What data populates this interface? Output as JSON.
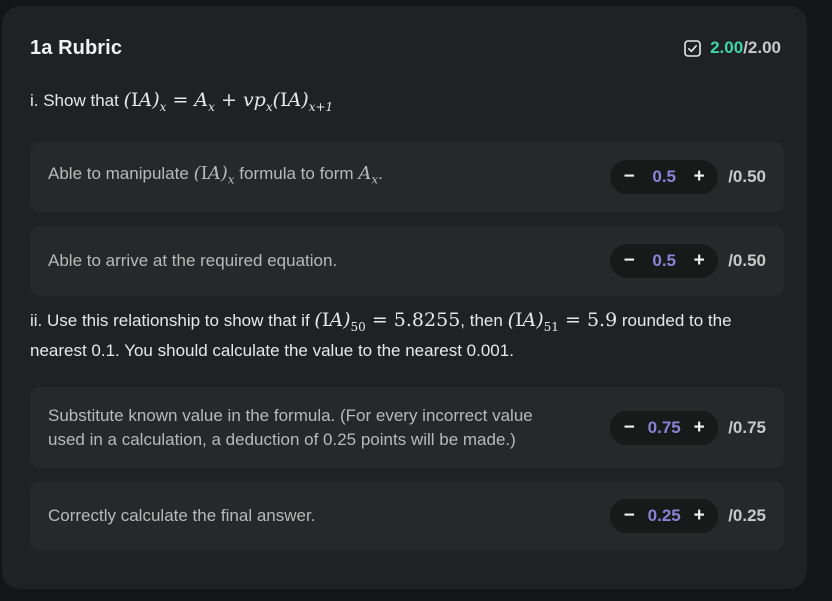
{
  "rubric": {
    "title": "1a Rubric",
    "score_earned": "2.00",
    "score_sep_total": "/2.00",
    "check_icon": "checkbox-checked-icon"
  },
  "part_i": {
    "prefix": "i. Show that",
    "equation": "(IA)x = Ax + vpx(IA)x+1"
  },
  "part_ii": {
    "line1_a": "ii. Use this relationship to show that if",
    "line1_b": ", then",
    "line1_c": "rounded to the",
    "line2": "nearest 0.1. You should calculate the value to the nearest 0.001.",
    "value_50": "5.8255",
    "value_51": "5.9"
  },
  "criteria": [
    {
      "text_a": "Able to manipulate",
      "text_b": "formula to form",
      "text_c": ".",
      "value": "0.5",
      "max": "/0.50"
    },
    {
      "text": "Able to arrive at the required equation.",
      "value": "0.5",
      "max": "/0.50"
    },
    {
      "text": "Substitute known value in the formula. (For every incorrect value used in a calculation, a deduction of 0.25 points will be made.)",
      "value": "0.75",
      "max": "/0.75"
    },
    {
      "text": "Correctly calculate the final answer.",
      "value": "0.25",
      "max": "/0.25"
    }
  ],
  "stepper": {
    "minus": "−",
    "plus": "+"
  }
}
